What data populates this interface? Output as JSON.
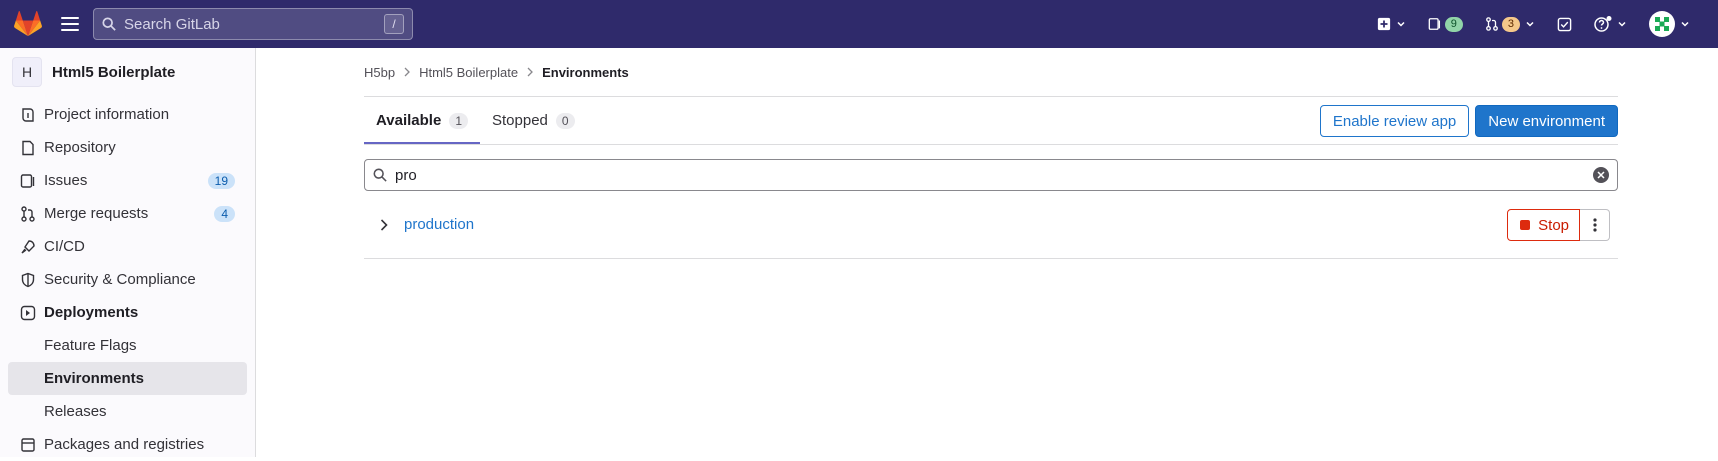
{
  "header": {
    "search_placeholder": "Search GitLab",
    "search_shortcut": "/",
    "issues_count": "9",
    "mr_count": "3"
  },
  "sidebar": {
    "project_initial": "H",
    "project_name": "Html5 Boilerplate",
    "items": [
      {
        "label": "Project information",
        "icon": "info-icon"
      },
      {
        "label": "Repository",
        "icon": "document-icon"
      },
      {
        "label": "Issues",
        "icon": "issues-icon",
        "count": "19"
      },
      {
        "label": "Merge requests",
        "icon": "merge-request-icon",
        "count": "4"
      },
      {
        "label": "CI/CD",
        "icon": "rocket-icon"
      },
      {
        "label": "Security & Compliance",
        "icon": "shield-icon"
      },
      {
        "label": "Deployments",
        "icon": "deployments-icon"
      },
      {
        "label": "Feature Flags"
      },
      {
        "label": "Environments"
      },
      {
        "label": "Releases"
      },
      {
        "label": "Packages and registries",
        "icon": "package-icon"
      }
    ]
  },
  "breadcrumb": [
    "H5bp",
    "Html5 Boilerplate",
    "Environments"
  ],
  "tabs": [
    {
      "label": "Available",
      "count": "1"
    },
    {
      "label": "Stopped",
      "count": "0"
    }
  ],
  "actions": {
    "enable_review_app": "Enable review app",
    "new_environment": "New environment"
  },
  "filter": {
    "value": "pro"
  },
  "environments": [
    {
      "name": "production",
      "stop_label": "Stop"
    }
  ],
  "colors": {
    "topbar": "#2f2a6b",
    "primary": "#1f75cb",
    "danger": "#dd2b0e"
  }
}
